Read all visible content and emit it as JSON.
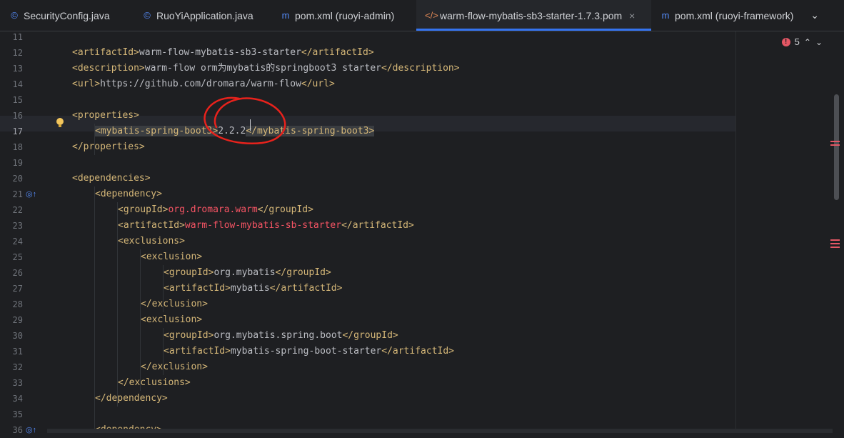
{
  "tabs": [
    {
      "label": "SecurityConfig.java",
      "icon": "c-class-icon",
      "glyph": "©",
      "color": "#548af7"
    },
    {
      "label": "RuoYiApplication.java",
      "icon": "c-class-icon",
      "glyph": "©",
      "color": "#548af7"
    },
    {
      "label": "pom.xml (ruoyi-admin)",
      "icon": "maven-icon",
      "glyph": "m",
      "color": "#548af7"
    },
    {
      "label": "warm-flow-mybatis-sb3-starter-1.7.3.pom",
      "icon": "xml-icon",
      "glyph": "</>",
      "color": "#e08855"
    },
    {
      "label": "pom.xml (ruoyi-framework)",
      "icon": "maven-icon",
      "glyph": "m",
      "color": "#548af7"
    }
  ],
  "inspection": {
    "count": "5",
    "accent": "#e55765"
  },
  "current_line": "17",
  "lines": [
    {
      "n": "11",
      "indent": 1,
      "parts": []
    },
    {
      "n": "12",
      "indent": 1,
      "parts": [
        [
          "tag",
          "<artifactId>"
        ],
        [
          "txt",
          "warm-flow-mybatis-sb3-starter"
        ],
        [
          "tag",
          "</artifactId>"
        ]
      ]
    },
    {
      "n": "13",
      "indent": 1,
      "parts": [
        [
          "tag",
          "<description>"
        ],
        [
          "txt",
          "warm-flow orm为mybatis的springboot3 starter"
        ],
        [
          "tag",
          "</description>"
        ]
      ]
    },
    {
      "n": "14",
      "indent": 1,
      "parts": [
        [
          "tag",
          "<url>"
        ],
        [
          "txt",
          "https://github.com/dromara/warm-flow"
        ],
        [
          "tag",
          "</url>"
        ]
      ]
    },
    {
      "n": "15",
      "indent": 1,
      "parts": []
    },
    {
      "n": "16",
      "indent": 1,
      "parts": [
        [
          "tag",
          "<properties>"
        ]
      ]
    },
    {
      "n": "17",
      "indent": 2,
      "parts": [
        [
          "tag hl",
          "<mybatis-spring-boot3>"
        ],
        [
          "txt",
          "2.2.2"
        ],
        [
          "tag hl",
          "</mybatis-spring-boot3>"
        ]
      ]
    },
    {
      "n": "18",
      "indent": 1,
      "parts": [
        [
          "tag",
          "</properties>"
        ]
      ]
    },
    {
      "n": "19",
      "indent": 1,
      "parts": []
    },
    {
      "n": "20",
      "indent": 1,
      "parts": [
        [
          "tag",
          "<dependencies>"
        ]
      ]
    },
    {
      "n": "21",
      "indent": 2,
      "parts": [
        [
          "tag",
          "<dependency>"
        ]
      ]
    },
    {
      "n": "22",
      "indent": 3,
      "parts": [
        [
          "tag",
          "<groupId>"
        ],
        [
          "ent",
          "org.dromara.warm"
        ],
        [
          "tag",
          "</groupId>"
        ]
      ]
    },
    {
      "n": "23",
      "indent": 3,
      "parts": [
        [
          "tag",
          "<artifactId>"
        ],
        [
          "ent",
          "warm-flow-mybatis-sb-starter"
        ],
        [
          "tag",
          "</artifactId>"
        ]
      ]
    },
    {
      "n": "24",
      "indent": 3,
      "parts": [
        [
          "tag",
          "<exclusions>"
        ]
      ]
    },
    {
      "n": "25",
      "indent": 4,
      "parts": [
        [
          "tag",
          "<exclusion>"
        ]
      ]
    },
    {
      "n": "26",
      "indent": 5,
      "parts": [
        [
          "tag",
          "<groupId>"
        ],
        [
          "txt",
          "org.mybatis"
        ],
        [
          "tag",
          "</groupId>"
        ]
      ]
    },
    {
      "n": "27",
      "indent": 5,
      "parts": [
        [
          "tag",
          "<artifactId>"
        ],
        [
          "txt",
          "mybatis"
        ],
        [
          "tag",
          "</artifactId>"
        ]
      ]
    },
    {
      "n": "28",
      "indent": 4,
      "parts": [
        [
          "tag",
          "</exclusion>"
        ]
      ]
    },
    {
      "n": "29",
      "indent": 4,
      "parts": [
        [
          "tag",
          "<exclusion>"
        ]
      ]
    },
    {
      "n": "30",
      "indent": 5,
      "parts": [
        [
          "tag",
          "<groupId>"
        ],
        [
          "txt",
          "org.mybatis.spring.boot"
        ],
        [
          "tag",
          "</groupId>"
        ]
      ]
    },
    {
      "n": "31",
      "indent": 5,
      "parts": [
        [
          "tag",
          "<artifactId>"
        ],
        [
          "txt",
          "mybatis-spring-boot-starter"
        ],
        [
          "tag",
          "</artifactId>"
        ]
      ]
    },
    {
      "n": "32",
      "indent": 4,
      "parts": [
        [
          "tag",
          "</exclusion>"
        ]
      ]
    },
    {
      "n": "33",
      "indent": 3,
      "parts": [
        [
          "tag",
          "</exclusions>"
        ]
      ]
    },
    {
      "n": "34",
      "indent": 2,
      "parts": [
        [
          "tag",
          "</dependency>"
        ]
      ]
    },
    {
      "n": "35",
      "indent": 1,
      "parts": []
    },
    {
      "n": "36",
      "indent": 2,
      "parts": [
        [
          "tag",
          "<dependency>"
        ]
      ]
    }
  ],
  "gutter_icons": [
    {
      "line": "21",
      "icon": "implemented-up-icon",
      "glyph": "◎↑"
    },
    {
      "line": "36",
      "icon": "implemented-up-icon",
      "glyph": "◎↑"
    }
  ],
  "colors": {
    "background": "#1e1f22",
    "tag": "#d5b778",
    "text": "#bcbec4",
    "highlight": "#f75464",
    "accent": "#3574f0"
  }
}
